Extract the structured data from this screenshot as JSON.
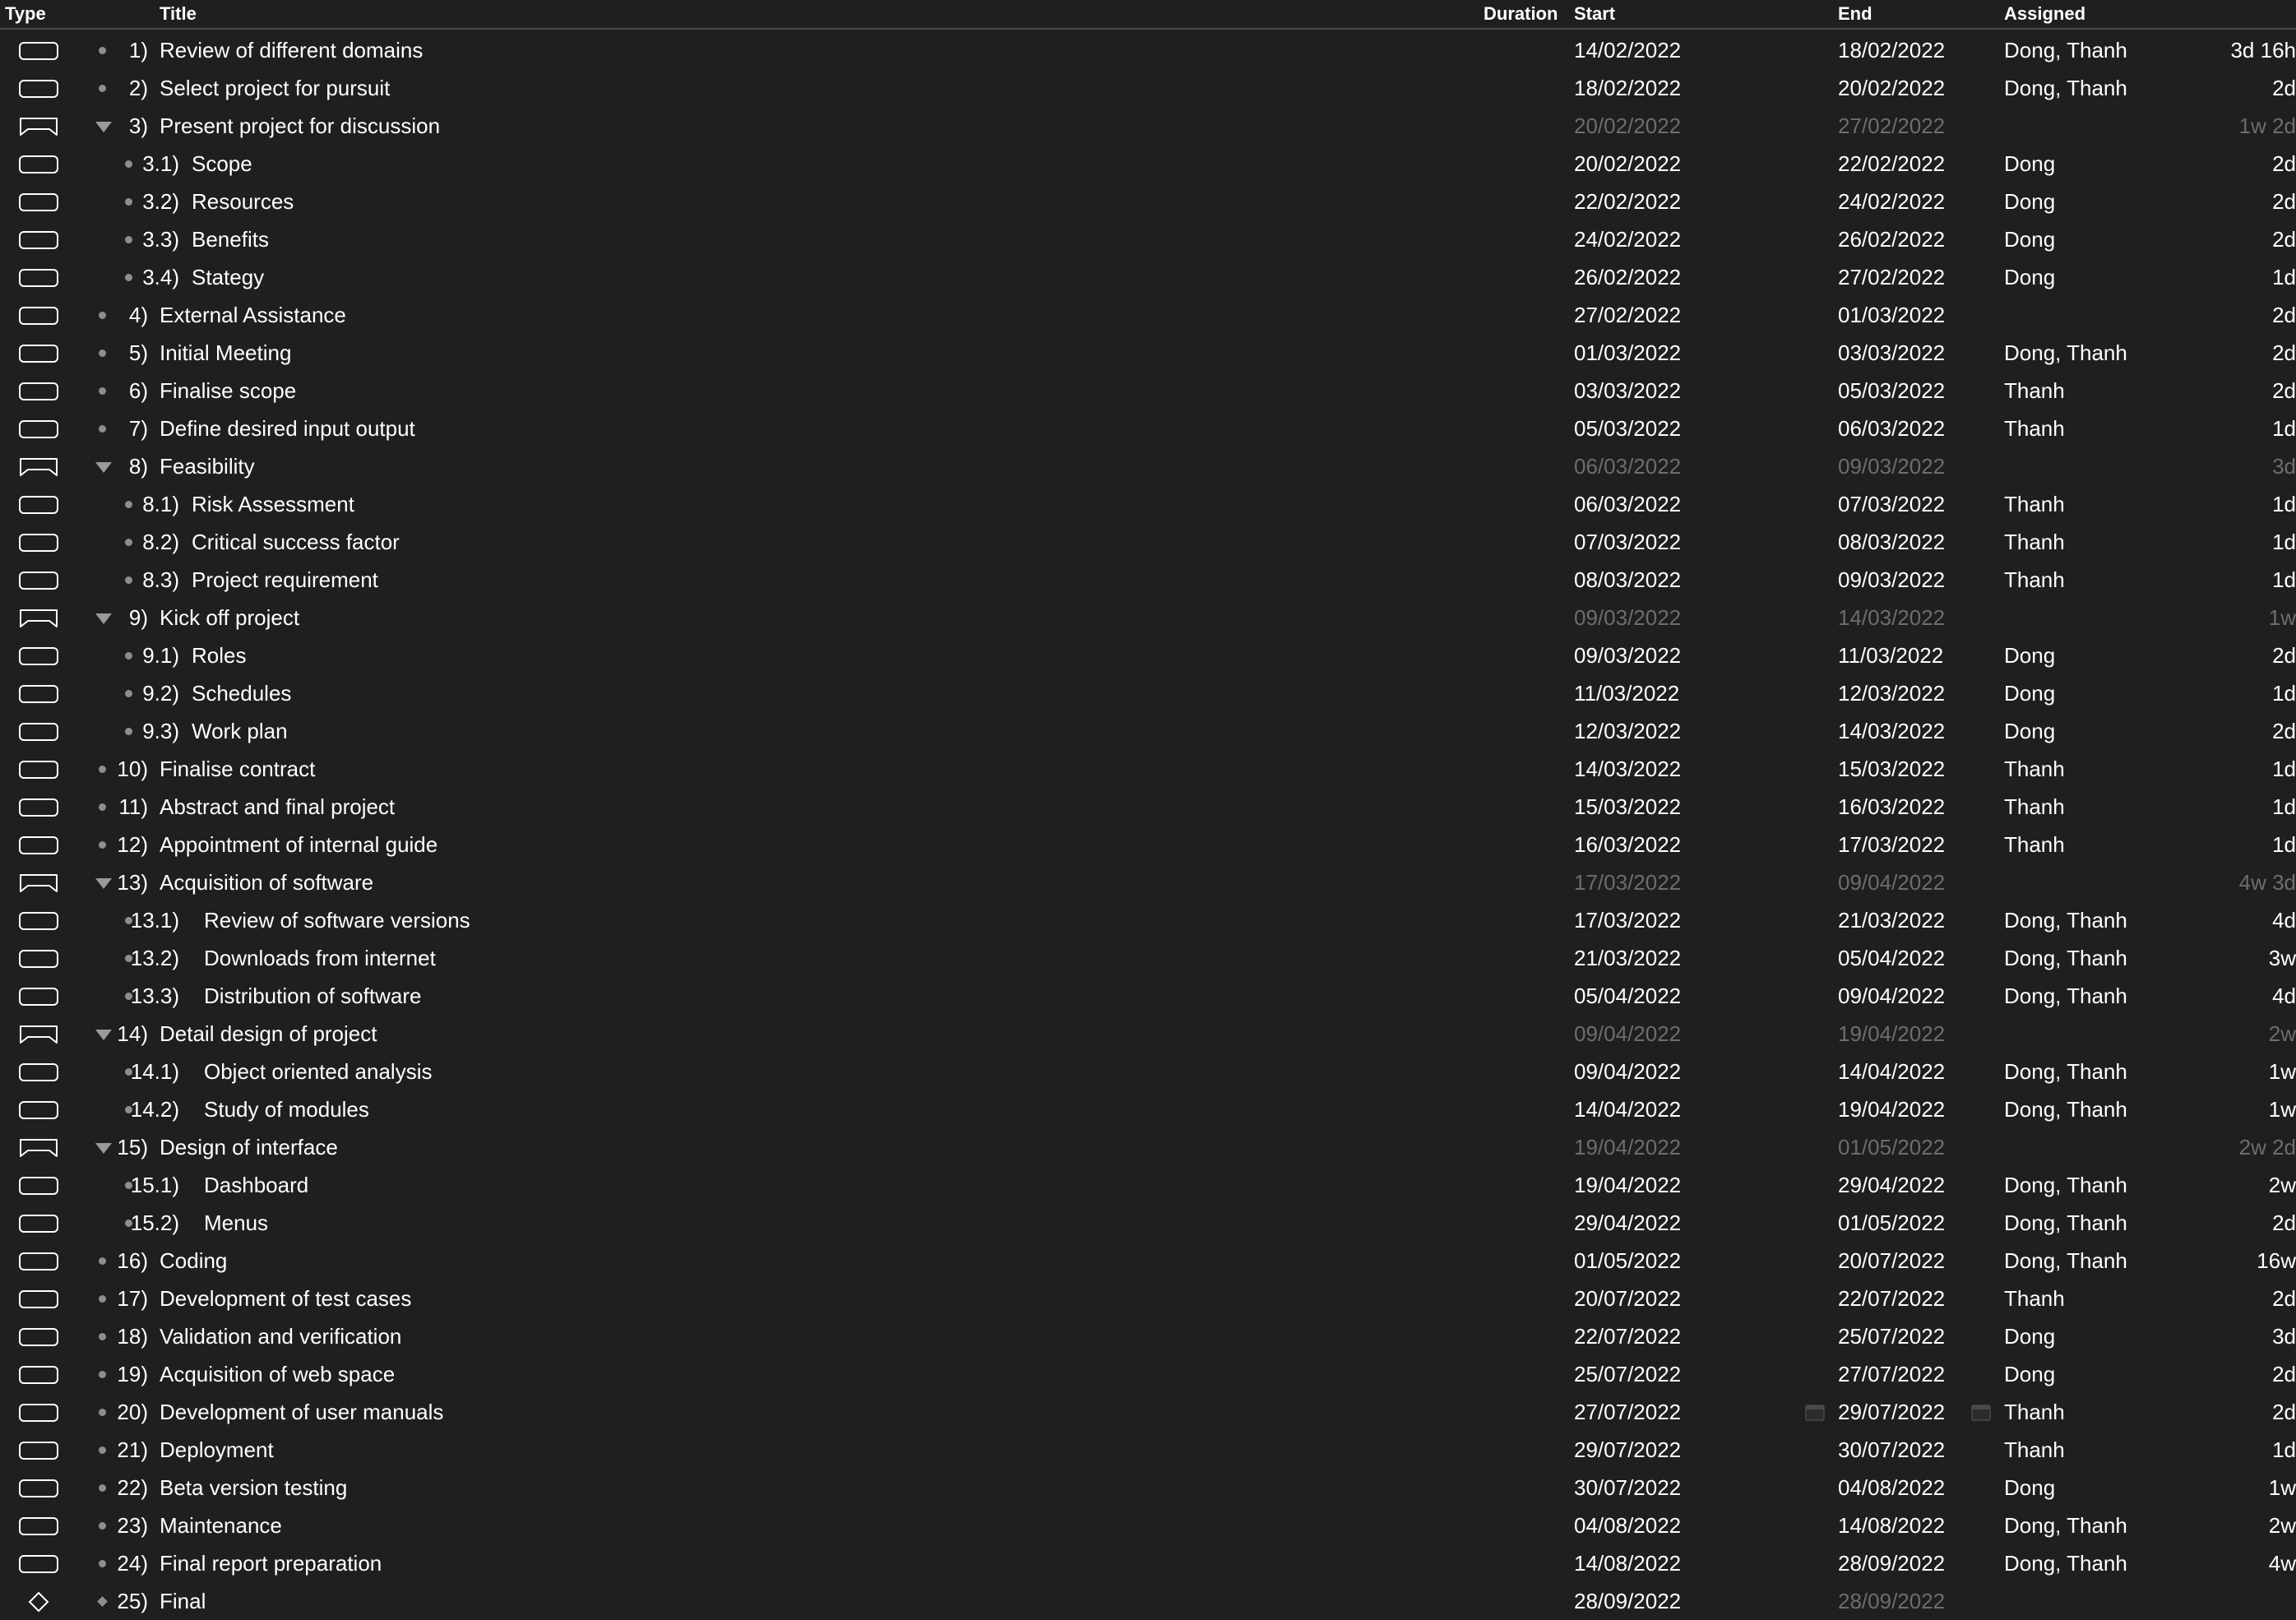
{
  "columns": {
    "type": "Type",
    "title": "Title",
    "duration": "Duration",
    "start": "Start",
    "end": "End",
    "assigned": "Assigned"
  },
  "colors": {
    "background": "#1f1f1f",
    "text": "#ffffff",
    "muted_text": "#6d6d6d",
    "icon_stroke": "#ffffff",
    "bullet": "#8e8e8e"
  },
  "tasks": [
    {
      "kind": "task",
      "level": 1,
      "collapsible": false,
      "num": "1)",
      "title": "Review of different domains",
      "duration": "3d 16h",
      "start": "14/02/2022",
      "end": "18/02/2022",
      "assigned": "Dong, Thanh"
    },
    {
      "kind": "task",
      "level": 1,
      "collapsible": false,
      "num": "2)",
      "title": "Select project for pursuit",
      "duration": "2d",
      "start": "18/02/2022",
      "end": "20/02/2022",
      "assigned": "Dong, Thanh"
    },
    {
      "kind": "group",
      "level": 1,
      "collapsible": true,
      "num": "3)",
      "title": "Present project for discussion",
      "duration": "1w 2d",
      "start": "20/02/2022",
      "end": "27/02/2022",
      "assigned": ""
    },
    {
      "kind": "task",
      "level": 2,
      "collapsible": false,
      "num": "3.1)",
      "title": "Scope",
      "duration": "2d",
      "start": "20/02/2022",
      "end": "22/02/2022",
      "assigned": "Dong"
    },
    {
      "kind": "task",
      "level": 2,
      "collapsible": false,
      "num": "3.2)",
      "title": "Resources",
      "duration": "2d",
      "start": "22/02/2022",
      "end": "24/02/2022",
      "assigned": "Dong"
    },
    {
      "kind": "task",
      "level": 2,
      "collapsible": false,
      "num": "3.3)",
      "title": "Benefits",
      "duration": "2d",
      "start": "24/02/2022",
      "end": "26/02/2022",
      "assigned": "Dong"
    },
    {
      "kind": "task",
      "level": 2,
      "collapsible": false,
      "num": "3.4)",
      "title": "Stategy",
      "duration": "1d",
      "start": "26/02/2022",
      "end": "27/02/2022",
      "assigned": "Dong"
    },
    {
      "kind": "task",
      "level": 1,
      "collapsible": false,
      "num": "4)",
      "title": "External Assistance",
      "duration": "2d",
      "start": "27/02/2022",
      "end": "01/03/2022",
      "assigned": ""
    },
    {
      "kind": "task",
      "level": 1,
      "collapsible": false,
      "num": "5)",
      "title": "Initial Meeting",
      "duration": "2d",
      "start": "01/03/2022",
      "end": "03/03/2022",
      "assigned": "Dong, Thanh"
    },
    {
      "kind": "task",
      "level": 1,
      "collapsible": false,
      "num": "6)",
      "title": "Finalise scope",
      "duration": "2d",
      "start": "03/03/2022",
      "end": "05/03/2022",
      "assigned": "Thanh"
    },
    {
      "kind": "task",
      "level": 1,
      "collapsible": false,
      "num": "7)",
      "title": "Define desired input output",
      "duration": "1d",
      "start": "05/03/2022",
      "end": "06/03/2022",
      "assigned": "Thanh"
    },
    {
      "kind": "group",
      "level": 1,
      "collapsible": true,
      "num": "8)",
      "title": "Feasibility",
      "duration": "3d",
      "start": "06/03/2022",
      "end": "09/03/2022",
      "assigned": ""
    },
    {
      "kind": "task",
      "level": 2,
      "collapsible": false,
      "num": "8.1)",
      "title": "Risk Assessment",
      "duration": "1d",
      "start": "06/03/2022",
      "end": "07/03/2022",
      "assigned": "Thanh"
    },
    {
      "kind": "task",
      "level": 2,
      "collapsible": false,
      "num": "8.2)",
      "title": "Critical success factor",
      "duration": "1d",
      "start": "07/03/2022",
      "end": "08/03/2022",
      "assigned": "Thanh"
    },
    {
      "kind": "task",
      "level": 2,
      "collapsible": false,
      "num": "8.3)",
      "title": "Project requirement",
      "duration": "1d",
      "start": "08/03/2022",
      "end": "09/03/2022",
      "assigned": "Thanh"
    },
    {
      "kind": "group",
      "level": 1,
      "collapsible": true,
      "num": "9)",
      "title": "Kick off project",
      "duration": "1w",
      "start": "09/03/2022",
      "end": "14/03/2022",
      "assigned": ""
    },
    {
      "kind": "task",
      "level": 2,
      "collapsible": false,
      "num": "9.1)",
      "title": "Roles",
      "duration": "2d",
      "start": "09/03/2022",
      "end": "11/03/2022",
      "assigned": "Dong"
    },
    {
      "kind": "task",
      "level": 2,
      "collapsible": false,
      "num": "9.2)",
      "title": "Schedules",
      "duration": "1d",
      "start": "11/03/2022",
      "end": "12/03/2022",
      "assigned": "Dong"
    },
    {
      "kind": "task",
      "level": 2,
      "collapsible": false,
      "num": "9.3)",
      "title": "Work plan",
      "duration": "2d",
      "start": "12/03/2022",
      "end": "14/03/2022",
      "assigned": "Dong"
    },
    {
      "kind": "task",
      "level": 1,
      "collapsible": false,
      "num": "10)",
      "title": "Finalise contract",
      "duration": "1d",
      "start": "14/03/2022",
      "end": "15/03/2022",
      "assigned": "Thanh"
    },
    {
      "kind": "task",
      "level": 1,
      "collapsible": false,
      "num": "11)",
      "title": "Abstract and final project",
      "duration": "1d",
      "start": "15/03/2022",
      "end": "16/03/2022",
      "assigned": "Thanh"
    },
    {
      "kind": "task",
      "level": 1,
      "collapsible": false,
      "num": "12)",
      "title": "Appointment of internal guide",
      "duration": "1d",
      "start": "16/03/2022",
      "end": "17/03/2022",
      "assigned": "Thanh"
    },
    {
      "kind": "group",
      "level": 1,
      "collapsible": true,
      "num": "13)",
      "title": "Acquisition of software",
      "duration": "4w 3d",
      "start": "17/03/2022",
      "end": "09/04/2022",
      "assigned": ""
    },
    {
      "kind": "task",
      "level": 2,
      "collapsible": false,
      "num": "13.1)",
      "title": "Review of software versions",
      "duration": "4d",
      "start": "17/03/2022",
      "end": "21/03/2022",
      "assigned": "Dong, Thanh"
    },
    {
      "kind": "task",
      "level": 2,
      "collapsible": false,
      "num": "13.2)",
      "title": "Downloads from internet",
      "duration": "3w",
      "start": "21/03/2022",
      "end": "05/04/2022",
      "assigned": "Dong, Thanh"
    },
    {
      "kind": "task",
      "level": 2,
      "collapsible": false,
      "num": "13.3)",
      "title": "Distribution of software",
      "duration": "4d",
      "start": "05/04/2022",
      "end": "09/04/2022",
      "assigned": "Dong, Thanh"
    },
    {
      "kind": "group",
      "level": 1,
      "collapsible": true,
      "num": "14)",
      "title": "Detail design of project",
      "duration": "2w",
      "start": "09/04/2022",
      "end": "19/04/2022",
      "assigned": ""
    },
    {
      "kind": "task",
      "level": 2,
      "collapsible": false,
      "num": "14.1)",
      "title": "Object oriented analysis",
      "duration": "1w",
      "start": "09/04/2022",
      "end": "14/04/2022",
      "assigned": "Dong, Thanh"
    },
    {
      "kind": "task",
      "level": 2,
      "collapsible": false,
      "num": "14.2)",
      "title": "Study of modules",
      "duration": "1w",
      "start": "14/04/2022",
      "end": "19/04/2022",
      "assigned": "Dong, Thanh"
    },
    {
      "kind": "group",
      "level": 1,
      "collapsible": true,
      "num": "15)",
      "title": "Design of interface",
      "duration": "2w 2d",
      "start": "19/04/2022",
      "end": "01/05/2022",
      "assigned": ""
    },
    {
      "kind": "task",
      "level": 2,
      "collapsible": false,
      "num": "15.1)",
      "title": "Dashboard",
      "duration": "2w",
      "start": "19/04/2022",
      "end": "29/04/2022",
      "assigned": "Dong, Thanh"
    },
    {
      "kind": "task",
      "level": 2,
      "collapsible": false,
      "num": "15.2)",
      "title": "Menus",
      "duration": "2d",
      "start": "29/04/2022",
      "end": "01/05/2022",
      "assigned": "Dong, Thanh"
    },
    {
      "kind": "task",
      "level": 1,
      "collapsible": false,
      "num": "16)",
      "title": "Coding",
      "duration": "16w",
      "start": "01/05/2022",
      "end": "20/07/2022",
      "assigned": "Dong, Thanh"
    },
    {
      "kind": "task",
      "level": 1,
      "collapsible": false,
      "num": "17)",
      "title": "Development of test cases",
      "duration": "2d",
      "start": "20/07/2022",
      "end": "22/07/2022",
      "assigned": "Thanh"
    },
    {
      "kind": "task",
      "level": 1,
      "collapsible": false,
      "num": "18)",
      "title": "Validation and verification",
      "duration": "3d",
      "start": "22/07/2022",
      "end": "25/07/2022",
      "assigned": "Dong"
    },
    {
      "kind": "task",
      "level": 1,
      "collapsible": false,
      "num": "19)",
      "title": "Acquisition of web space",
      "duration": "2d",
      "start": "25/07/2022",
      "end": "27/07/2022",
      "assigned": "Dong"
    },
    {
      "kind": "task",
      "level": 1,
      "collapsible": false,
      "num": "20)",
      "title": "Development of user manuals",
      "duration": "2d",
      "start": "27/07/2022",
      "end": "29/07/2022",
      "assigned": "Thanh",
      "show_calendar": true
    },
    {
      "kind": "task",
      "level": 1,
      "collapsible": false,
      "num": "21)",
      "title": "Deployment",
      "duration": "1d",
      "start": "29/07/2022",
      "end": "30/07/2022",
      "assigned": "Thanh"
    },
    {
      "kind": "task",
      "level": 1,
      "collapsible": false,
      "num": "22)",
      "title": "Beta version testing",
      "duration": "1w",
      "start": "30/07/2022",
      "end": "04/08/2022",
      "assigned": "Dong"
    },
    {
      "kind": "task",
      "level": 1,
      "collapsible": false,
      "num": "23)",
      "title": "Maintenance",
      "duration": "2w",
      "start": "04/08/2022",
      "end": "14/08/2022",
      "assigned": "Dong, Thanh"
    },
    {
      "kind": "task",
      "level": 1,
      "collapsible": false,
      "num": "24)",
      "title": "Final report preparation",
      "duration": "4w",
      "start": "14/08/2022",
      "end": "28/09/2022",
      "assigned": "Dong, Thanh"
    },
    {
      "kind": "milestone",
      "level": 1,
      "collapsible": false,
      "num": "25)",
      "title": "Final",
      "duration": "",
      "start": "28/09/2022",
      "end": "28/09/2022",
      "assigned": ""
    }
  ]
}
